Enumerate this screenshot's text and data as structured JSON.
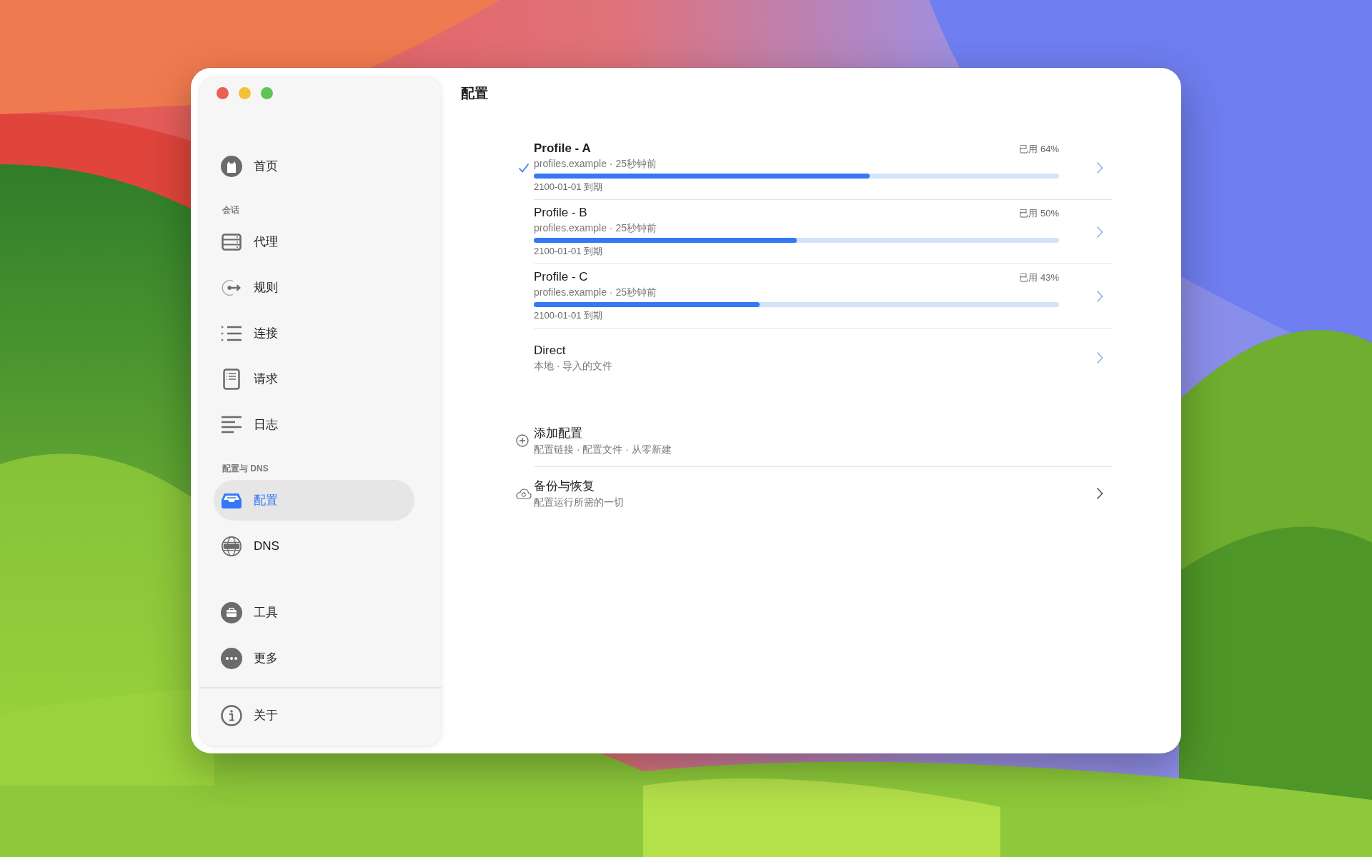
{
  "window": {
    "title": "配置"
  },
  "sidebar": {
    "groups": [
      {
        "items": [
          {
            "label": "首页",
            "selected": false
          }
        ]
      },
      {
        "header": "会话",
        "items": [
          {
            "label": "代理",
            "selected": false
          },
          {
            "label": "规则",
            "selected": false
          },
          {
            "label": "连接",
            "selected": false
          },
          {
            "label": "请求",
            "selected": false
          },
          {
            "label": "日志",
            "selected": false
          }
        ]
      },
      {
        "header": "配置与 DNS",
        "items": [
          {
            "label": "配置",
            "selected": true
          },
          {
            "label": "DNS",
            "selected": false
          }
        ]
      },
      {
        "items": [
          {
            "label": "工具",
            "selected": false
          },
          {
            "label": "更多",
            "selected": false
          }
        ]
      },
      {
        "items": [
          {
            "label": "关于",
            "selected": false
          }
        ]
      }
    ]
  },
  "profiles": [
    {
      "kind": "subscription",
      "name": "Profile - A",
      "source": "profiles.example · 25秒钟前",
      "usage": "已用 64%",
      "level": 0.64,
      "expiry": "2100-01-01 到期",
      "selected": true
    },
    {
      "kind": "subscription",
      "name": "Profile - B",
      "source": "profiles.example · 25秒钟前",
      "usage": "已用 50%",
      "level": 0.5,
      "expiry": "2100-01-01 到期",
      "selected": false
    },
    {
      "kind": "subscription",
      "name": "Profile - C",
      "source": "profiles.example · 25秒钟前",
      "usage": "已用 43%",
      "level": 0.43,
      "expiry": "2100-01-01 到期",
      "selected": false
    },
    {
      "kind": "local",
      "name": "Direct",
      "source": "本地 · 导入的文件",
      "selected": false
    }
  ],
  "actions": [
    {
      "kind": "add",
      "title": "添加配置",
      "subtitle": "配置链接 · 配置文件 · 从零新建"
    },
    {
      "kind": "backup",
      "title": "备份与恢复",
      "subtitle": "配置运行所需的一切"
    }
  ]
}
